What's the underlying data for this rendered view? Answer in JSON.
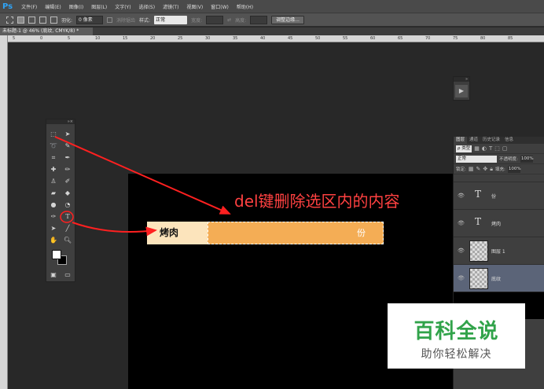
{
  "app": {
    "logo": "Ps"
  },
  "menu": [
    "文件(F)",
    "编辑(E)",
    "图像(I)",
    "图层(L)",
    "文字(Y)",
    "选择(S)",
    "滤镜(T)",
    "视图(V)",
    "窗口(W)",
    "帮助(H)"
  ],
  "options": {
    "feather_label": "羽化:",
    "feather_value": "0 像素",
    "antialias_label": "消除锯齿",
    "style_label": "样式:",
    "style_value": "正常",
    "width_label": "宽度:",
    "height_label": "高度:",
    "refine_button": "调整边缘..."
  },
  "document": {
    "tab_title": "未标题-1 @ 46% (底纹, CMYK/8) *"
  },
  "ruler": {
    "h_ticks": [
      "5",
      "0",
      "5",
      "10",
      "15",
      "20",
      "25",
      "30",
      "35",
      "40",
      "45",
      "50",
      "55",
      "60",
      "65",
      "70",
      "75",
      "80",
      "85"
    ]
  },
  "canvas": {
    "bar_label": "烤肉",
    "bar_value": "份",
    "annotation": "del键删除选区内的内容",
    "annotation_color": "#ff4141"
  },
  "layers_panel": {
    "tabs": [
      "图层",
      "通道",
      "历史记录",
      "信息"
    ],
    "filter": "ρ 类型",
    "blend_mode": "正常",
    "opacity_label": "不透明度:",
    "opacity_value": "100%",
    "lock_label": "锁定:",
    "fill_label": "填充:",
    "fill_value": "100%",
    "layers": [
      {
        "name": "份",
        "type": "text"
      },
      {
        "name": "烤肉",
        "type": "text"
      },
      {
        "name": "图层 1",
        "type": "pixel"
      },
      {
        "name": "底纹",
        "type": "pixel",
        "selected": true
      }
    ]
  },
  "watermark": {
    "title": "百科全说",
    "subtitle": "助你轻松解决",
    "color": "#31a34a"
  }
}
